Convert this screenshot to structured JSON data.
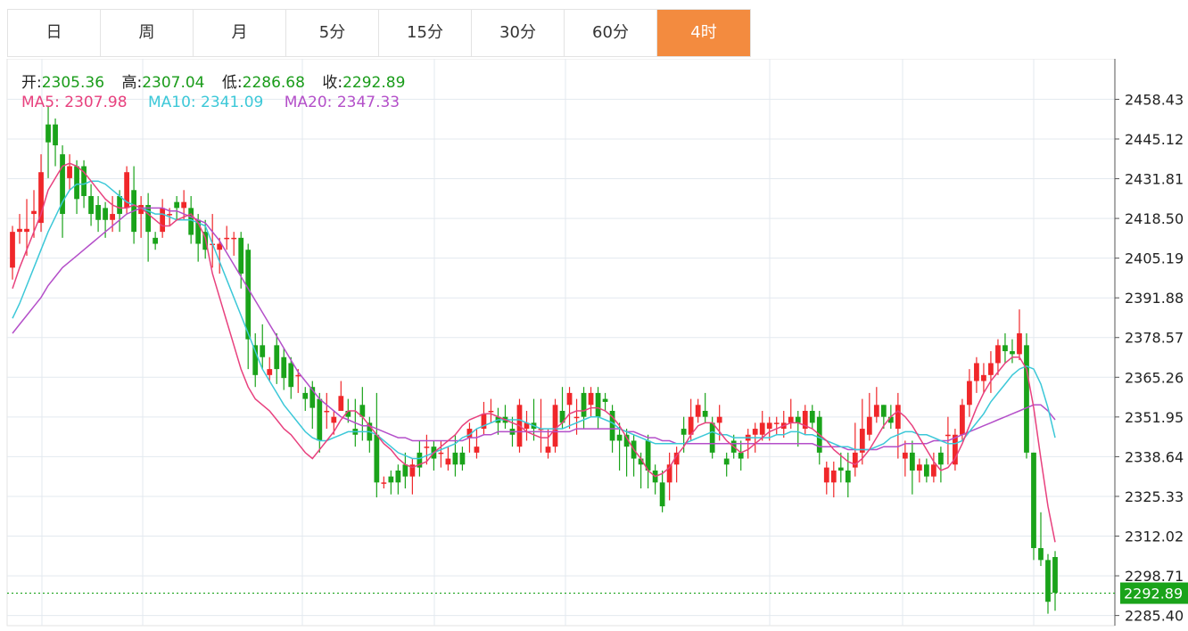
{
  "tabs": [
    {
      "label": "日",
      "active": false
    },
    {
      "label": "周",
      "active": false
    },
    {
      "label": "月",
      "active": false
    },
    {
      "label": "5分",
      "active": false
    },
    {
      "label": "15分",
      "active": false
    },
    {
      "label": "30分",
      "active": false
    },
    {
      "label": "60分",
      "active": false
    },
    {
      "label": "4时",
      "active": true
    }
  ],
  "ohlc_info": {
    "open_label": "开:",
    "open": "2305.36",
    "high_label": "高:",
    "high": "2307.04",
    "low_label": "低:",
    "low": "2286.68",
    "close_label": "收:",
    "close": "2292.89"
  },
  "ma_info": {
    "ma5_label": "MA5:",
    "ma5": "2307.98",
    "ma10_label": "MA10:",
    "ma10": "2341.09",
    "ma20_label": "MA20:",
    "ma20": "2347.33"
  },
  "colors": {
    "up": "#f0272a",
    "down": "#1aa31a",
    "ma5": "#e8417e",
    "ma10": "#3cc8d8",
    "ma20": "#b44fc9",
    "grid": "#e3e9ef",
    "last_price_bg": "#1aa31a",
    "active_tab": "#f38b3f"
  },
  "chart_data": {
    "type": "candlestick",
    "ylim": [
      2282,
      2472
    ],
    "y_ticks": [
      "2458.43",
      "2445.12",
      "2431.81",
      "2418.50",
      "2405.19",
      "2391.88",
      "2378.57",
      "2365.26",
      "2351.95",
      "2338.64",
      "2325.33",
      "2312.02",
      "2298.71",
      "2285.40"
    ],
    "last_price": "2292.89",
    "candles": [
      [
        2402,
        2414,
        2398,
        2416
      ],
      [
        2414,
        2415,
        2410,
        2420
      ],
      [
        2414,
        2415,
        2406,
        2425
      ],
      [
        2420,
        2421,
        2412,
        2428
      ],
      [
        2417,
        2434,
        2414,
        2440
      ],
      [
        2450,
        2444,
        2432,
        2456
      ],
      [
        2450,
        2443,
        2436,
        2452
      ],
      [
        2440,
        2420,
        2412,
        2443
      ],
      [
        2432,
        2436,
        2428,
        2440
      ],
      [
        2436,
        2425,
        2420,
        2438
      ],
      [
        2436,
        2426,
        2422,
        2438
      ],
      [
        2426,
        2420,
        2416,
        2430
      ],
      [
        2423,
        2418,
        2414,
        2426
      ],
      [
        2422,
        2418,
        2412,
        2424
      ],
      [
        2418,
        2420,
        2414,
        2426
      ],
      [
        2426,
        2420,
        2414,
        2428
      ],
      [
        2422,
        2434,
        2420,
        2436
      ],
      [
        2428,
        2414,
        2410,
        2436
      ],
      [
        2420,
        2423,
        2412,
        2426
      ],
      [
        2423,
        2414,
        2404,
        2427
      ],
      [
        2412,
        2410,
        2408,
        2414
      ],
      [
        2414,
        2422,
        2412,
        2425
      ],
      [
        2420,
        2420,
        2416,
        2422
      ],
      [
        2424,
        2422,
        2418,
        2426
      ],
      [
        2422,
        2424,
        2418,
        2428
      ],
      [
        2422,
        2413,
        2410,
        2426
      ],
      [
        2418,
        2410,
        2404,
        2420
      ],
      [
        2414,
        2408,
        2405,
        2418
      ],
      [
        2410,
        2410,
        2402,
        2420
      ],
      [
        2408,
        2410,
        2400,
        2412
      ],
      [
        2412,
        2412,
        2408,
        2416
      ],
      [
        2412,
        2412,
        2406,
        2414
      ],
      [
        2412,
        2400,
        2395,
        2414
      ],
      [
        2408,
        2378,
        2368,
        2410
      ],
      [
        2376,
        2366,
        2362,
        2380
      ],
      [
        2376,
        2372,
        2368,
        2383
      ],
      [
        2366,
        2368,
        2364,
        2372
      ],
      [
        2376,
        2368,
        2363,
        2380
      ],
      [
        2372,
        2365,
        2361,
        2375
      ],
      [
        2370,
        2362,
        2358,
        2372
      ],
      [
        2366,
        2366,
        2360,
        2368
      ],
      [
        2360,
        2358,
        2354,
        2362
      ],
      [
        2362,
        2355,
        2348,
        2364
      ],
      [
        2358,
        2344,
        2340,
        2360
      ],
      [
        2354,
        2354,
        2348,
        2360
      ],
      [
        2350,
        2352,
        2346,
        2354
      ],
      [
        2354,
        2359,
        2354,
        2364
      ],
      [
        2354,
        2352,
        2350,
        2358
      ],
      [
        2348,
        2346,
        2342,
        2358
      ],
      [
        2356,
        2352,
        2344,
        2362
      ],
      [
        2350,
        2344,
        2340,
        2352
      ],
      [
        2346,
        2330,
        2325,
        2360
      ],
      [
        2330,
        2330,
        2328,
        2332
      ],
      [
        2332,
        2330,
        2326,
        2334
      ],
      [
        2334,
        2330,
        2326,
        2336
      ],
      [
        2336,
        2332,
        2328,
        2340
      ],
      [
        2332,
        2336,
        2326,
        2338
      ],
      [
        2340,
        2335,
        2332,
        2344
      ],
      [
        2342,
        2342,
        2336,
        2346
      ],
      [
        2342,
        2338,
        2334,
        2344
      ],
      [
        2340,
        2340,
        2335,
        2344
      ],
      [
        2336,
        2338,
        2334,
        2342
      ],
      [
        2340,
        2336,
        2332,
        2346
      ],
      [
        2340,
        2336,
        2334,
        2342
      ],
      [
        2345,
        2348,
        2340,
        2350
      ],
      [
        2340,
        2342,
        2338,
        2348
      ],
      [
        2348,
        2353,
        2346,
        2357
      ],
      [
        2354,
        2354,
        2350,
        2358
      ],
      [
        2352,
        2350,
        2346,
        2355
      ],
      [
        2352,
        2350,
        2348,
        2356
      ],
      [
        2348,
        2346,
        2342,
        2352
      ],
      [
        2342,
        2356,
        2340,
        2358
      ],
      [
        2348,
        2350,
        2344,
        2354
      ],
      [
        2350,
        2348,
        2344,
        2358
      ],
      [
        2348,
        2348,
        2340,
        2358
      ],
      [
        2340,
        2342,
        2338,
        2348
      ],
      [
        2342,
        2356,
        2340,
        2358
      ],
      [
        2354,
        2350,
        2348,
        2362
      ],
      [
        2356,
        2360,
        2348,
        2362
      ],
      [
        2352,
        2352,
        2346,
        2358
      ],
      [
        2360,
        2352,
        2348,
        2362
      ],
      [
        2356,
        2360,
        2352,
        2362
      ],
      [
        2360,
        2352,
        2348,
        2362
      ],
      [
        2358,
        2357,
        2354,
        2360
      ],
      [
        2354,
        2344,
        2340,
        2356
      ],
      [
        2346,
        2344,
        2334,
        2350
      ],
      [
        2346,
        2342,
        2332,
        2348
      ],
      [
        2344,
        2338,
        2332,
        2346
      ],
      [
        2338,
        2336,
        2328,
        2340
      ],
      [
        2344,
        2334,
        2328,
        2346
      ],
      [
        2334,
        2330,
        2326,
        2336
      ],
      [
        2330,
        2322,
        2320,
        2334
      ],
      [
        2330,
        2336,
        2324,
        2340
      ],
      [
        2336,
        2340,
        2330,
        2342
      ],
      [
        2348,
        2346,
        2340,
        2352
      ],
      [
        2346,
        2352,
        2344,
        2358
      ],
      [
        2352,
        2356,
        2350,
        2358
      ],
      [
        2354,
        2352,
        2350,
        2360
      ],
      [
        2350,
        2340,
        2338,
        2352
      ],
      [
        2350,
        2352,
        2344,
        2356
      ],
      [
        2338,
        2336,
        2332,
        2340
      ],
      [
        2344,
        2340,
        2338,
        2346
      ],
      [
        2340,
        2338,
        2334,
        2344
      ],
      [
        2344,
        2346,
        2338,
        2348
      ],
      [
        2346,
        2348,
        2340,
        2350
      ],
      [
        2346,
        2350,
        2344,
        2354
      ],
      [
        2348,
        2350,
        2344,
        2352
      ],
      [
        2350,
        2350,
        2346,
        2352
      ],
      [
        2348,
        2350,
        2345,
        2354
      ],
      [
        2350,
        2352,
        2348,
        2358
      ],
      [
        2352,
        2350,
        2342,
        2354
      ],
      [
        2348,
        2354,
        2346,
        2356
      ],
      [
        2354,
        2350,
        2348,
        2356
      ],
      [
        2352,
        2340,
        2336,
        2354
      ],
      [
        2330,
        2335,
        2326,
        2337
      ],
      [
        2330,
        2334,
        2325,
        2337
      ],
      [
        2335,
        2334,
        2330,
        2340
      ],
      [
        2334,
        2330,
        2325,
        2340
      ],
      [
        2335,
        2340,
        2332,
        2350
      ],
      [
        2340,
        2348,
        2336,
        2358
      ],
      [
        2346,
        2352,
        2344,
        2360
      ],
      [
        2352,
        2356,
        2350,
        2362
      ],
      [
        2356,
        2352,
        2348,
        2356
      ],
      [
        2352,
        2350,
        2348,
        2356
      ],
      [
        2348,
        2356,
        2338,
        2360
      ],
      [
        2338,
        2340,
        2332,
        2344
      ],
      [
        2340,
        2334,
        2326,
        2344
      ],
      [
        2334,
        2336,
        2330,
        2338
      ],
      [
        2336,
        2332,
        2330,
        2338
      ],
      [
        2332,
        2336,
        2330,
        2340
      ],
      [
        2340,
        2336,
        2330,
        2342
      ],
      [
        2346,
        2346,
        2336,
        2352
      ],
      [
        2336,
        2346,
        2334,
        2348
      ],
      [
        2346,
        2356,
        2344,
        2358
      ],
      [
        2356,
        2364,
        2352,
        2368
      ],
      [
        2364,
        2370,
        2360,
        2372
      ],
      [
        2364,
        2366,
        2360,
        2370
      ],
      [
        2366,
        2370,
        2360,
        2374
      ],
      [
        2370,
        2376,
        2366,
        2378
      ],
      [
        2376,
        2374,
        2370,
        2380
      ],
      [
        2374,
        2373,
        2370,
        2378
      ],
      [
        2373,
        2380,
        2371,
        2388
      ],
      [
        2376,
        2340,
        2338,
        2380
      ],
      [
        2340,
        2308,
        2304,
        2340
      ],
      [
        2308,
        2304,
        2302,
        2320
      ],
      [
        2304,
        2290,
        2286,
        2306
      ],
      [
        2305,
        2293,
        2287,
        2307
      ]
    ],
    "ma5": [
      2395,
      2402,
      2408,
      2414,
      2420,
      2428,
      2432,
      2436,
      2437,
      2436,
      2434,
      2431,
      2428,
      2425,
      2423,
      2422,
      2422,
      2423,
      2422,
      2420,
      2418,
      2416,
      2416,
      2418,
      2419,
      2420,
      2417,
      2412,
      2400,
      2392,
      2384,
      2376,
      2368,
      2362,
      2358,
      2356,
      2354,
      2351,
      2348,
      2346,
      2343,
      2340,
      2338,
      2341,
      2344,
      2347,
      2351,
      2354,
      2354,
      2352,
      2349,
      2346,
      2343,
      2341,
      2338,
      2336,
      2335,
      2336,
      2337,
      2340,
      2342,
      2344,
      2346,
      2349,
      2351,
      2352,
      2353,
      2353,
      2352,
      2351,
      2350,
      2349,
      2347,
      2346,
      2345,
      2345,
      2348,
      2350,
      2353,
      2354,
      2354,
      2355,
      2355,
      2354,
      2352,
      2349,
      2345,
      2341,
      2338,
      2334,
      2332,
      2333,
      2335,
      2339,
      2342,
      2346,
      2349,
      2350,
      2350,
      2347,
      2344,
      2342,
      2340,
      2341,
      2343,
      2345,
      2347,
      2348,
      2349,
      2350,
      2350,
      2349,
      2348,
      2346,
      2344,
      2341,
      2339,
      2337,
      2336,
      2338,
      2341,
      2345,
      2349,
      2352,
      2354,
      2352,
      2349,
      2345,
      2341,
      2337,
      2334,
      2335,
      2338,
      2343,
      2349,
      2355,
      2360,
      2364,
      2367,
      2370,
      2372,
      2372,
      2368,
      2355,
      2338,
      2322,
      2310
    ],
    "ma10": [
      2385,
      2390,
      2396,
      2402,
      2408,
      2414,
      2419,
      2424,
      2428,
      2430,
      2430,
      2431,
      2431,
      2430,
      2428,
      2426,
      2424,
      2423,
      2422,
      2421,
      2420,
      2420,
      2419,
      2418,
      2418,
      2418,
      2417,
      2416,
      2410,
      2404,
      2398,
      2392,
      2386,
      2380,
      2374,
      2368,
      2364,
      2360,
      2356,
      2353,
      2350,
      2347,
      2345,
      2344,
      2344,
      2345,
      2346,
      2347,
      2347,
      2347,
      2347,
      2346,
      2344,
      2342,
      2340,
      2339,
      2338,
      2338,
      2339,
      2340,
      2341,
      2342,
      2343,
      2345,
      2346,
      2348,
      2349,
      2350,
      2351,
      2351,
      2351,
      2351,
      2350,
      2349,
      2348,
      2348,
      2348,
      2348,
      2349,
      2350,
      2351,
      2352,
      2352,
      2351,
      2350,
      2348,
      2347,
      2346,
      2345,
      2344,
      2343,
      2343,
      2343,
      2343,
      2343,
      2344,
      2345,
      2346,
      2347,
      2346,
      2346,
      2345,
      2345,
      2345,
      2345,
      2345,
      2345,
      2346,
      2346,
      2347,
      2347,
      2346,
      2346,
      2345,
      2344,
      2343,
      2342,
      2342,
      2341,
      2341,
      2341,
      2342,
      2343,
      2345,
      2346,
      2347,
      2347,
      2346,
      2346,
      2345,
      2344,
      2343,
      2343,
      2344,
      2347,
      2350,
      2353,
      2357,
      2360,
      2363,
      2366,
      2368,
      2369,
      2368,
      2363,
      2355,
      2345
    ],
    "ma20": [
      2380,
      2383,
      2386,
      2389,
      2392,
      2396,
      2399,
      2402,
      2404,
      2406,
      2408,
      2410,
      2412,
      2414,
      2416,
      2418,
      2420,
      2421,
      2422,
      2422,
      2422,
      2422,
      2421,
      2421,
      2420,
      2419,
      2418,
      2417,
      2414,
      2411,
      2407,
      2403,
      2399,
      2395,
      2391,
      2387,
      2383,
      2379,
      2375,
      2371,
      2367,
      2364,
      2361,
      2358,
      2356,
      2354,
      2352,
      2351,
      2350,
      2349,
      2349,
      2348,
      2347,
      2346,
      2345,
      2345,
      2344,
      2344,
      2344,
      2344,
      2344,
      2344,
      2344,
      2344,
      2345,
      2345,
      2346,
      2346,
      2347,
      2347,
      2347,
      2347,
      2347,
      2347,
      2347,
      2347,
      2347,
      2347,
      2347,
      2348,
      2348,
      2348,
      2348,
      2348,
      2348,
      2348,
      2347,
      2347,
      2346,
      2345,
      2345,
      2344,
      2344,
      2343,
      2343,
      2343,
      2343,
      2343,
      2343,
      2343,
      2343,
      2343,
      2343,
      2343,
      2343,
      2343,
      2343,
      2343,
      2343,
      2343,
      2343,
      2343,
      2343,
      2342,
      2342,
      2342,
      2342,
      2341,
      2341,
      2341,
      2341,
      2341,
      2342,
      2342,
      2342,
      2343,
      2343,
      2343,
      2343,
      2344,
      2344,
      2344,
      2345,
      2346,
      2347,
      2348,
      2349,
      2350,
      2351,
      2352,
      2353,
      2354,
      2355,
      2356,
      2356,
      2354,
      2351
    ]
  }
}
